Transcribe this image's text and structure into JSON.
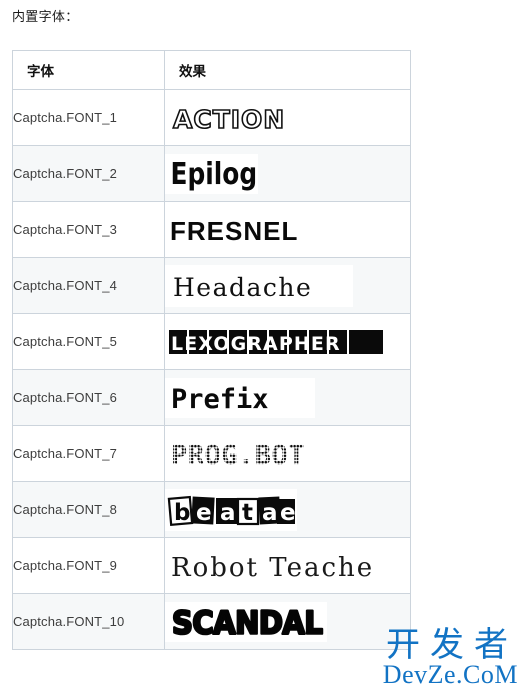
{
  "page": {
    "intro": "内置字体："
  },
  "table": {
    "headers": {
      "name": "字体",
      "effect": "效果"
    },
    "rows": [
      {
        "name": "Captcha.FONT_1",
        "sample_text": "ACTION",
        "style": "outline"
      },
      {
        "name": "Captcha.FONT_2",
        "sample_text": "Epilog",
        "style": "heavy"
      },
      {
        "name": "Captcha.FONT_3",
        "sample_text": "FRESNEL",
        "style": "cond"
      },
      {
        "name": "Captcha.FONT_4",
        "sample_text": "Headache",
        "style": "serif"
      },
      {
        "name": "Captcha.FONT_5",
        "sample_text": "LEXOGRAPHER",
        "style": "boxed"
      },
      {
        "name": "Captcha.FONT_6",
        "sample_text": "Prefix",
        "style": "mono"
      },
      {
        "name": "Captcha.FONT_7",
        "sample_text": "PROG.BOT",
        "style": "dotmatrix"
      },
      {
        "name": "Captcha.FONT_8",
        "sample_text": "beatae",
        "style": "ransom"
      },
      {
        "name": "Captcha.FONT_9",
        "sample_text": "Robot Teacher",
        "style": "thin-serif"
      },
      {
        "name": "Captcha.FONT_10",
        "sample_text": "SCANDAL",
        "style": "round"
      }
    ]
  },
  "watermark": {
    "cn": "开发者",
    "en": "DevZe.CoM",
    "color": "#1273c4"
  },
  "colors": {
    "border": "#ccd4dc",
    "row_alt_background": "#f6f8f9",
    "row_background": "#ffffff",
    "text": "#3d3d3d",
    "heading_text": "#111111"
  }
}
